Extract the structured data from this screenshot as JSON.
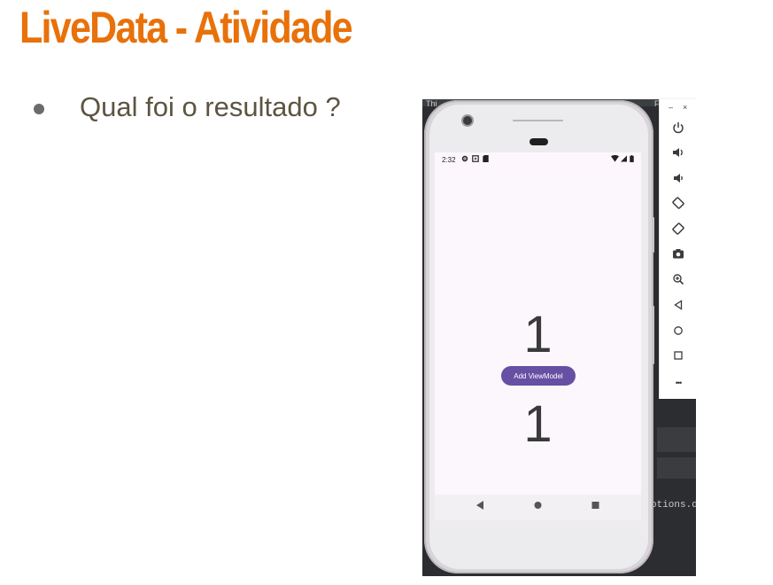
{
  "slide": {
    "title": "LiveData - Atividade",
    "bullet": "Qual foi o resultado ?"
  },
  "ide": {
    "title_left": "Thi",
    "title_right": "F",
    "code_snippet": "otions.d"
  },
  "emulator": {
    "status_time": "2:32",
    "counter_top": "1",
    "counter_bottom": "1",
    "button_label": "Add ViewModel",
    "accent_color": "#6650a4",
    "screen_bg": "#fcf6fd"
  },
  "toolbar": {
    "minimize": "–",
    "close": "×",
    "icons": [
      "power-icon",
      "volume-up-icon",
      "volume-down-icon",
      "rotate-left-icon",
      "rotate-right-icon",
      "camera-icon",
      "zoom-icon",
      "back-icon",
      "home-icon",
      "overview-icon",
      "more-icon"
    ],
    "more_label": "•••"
  }
}
